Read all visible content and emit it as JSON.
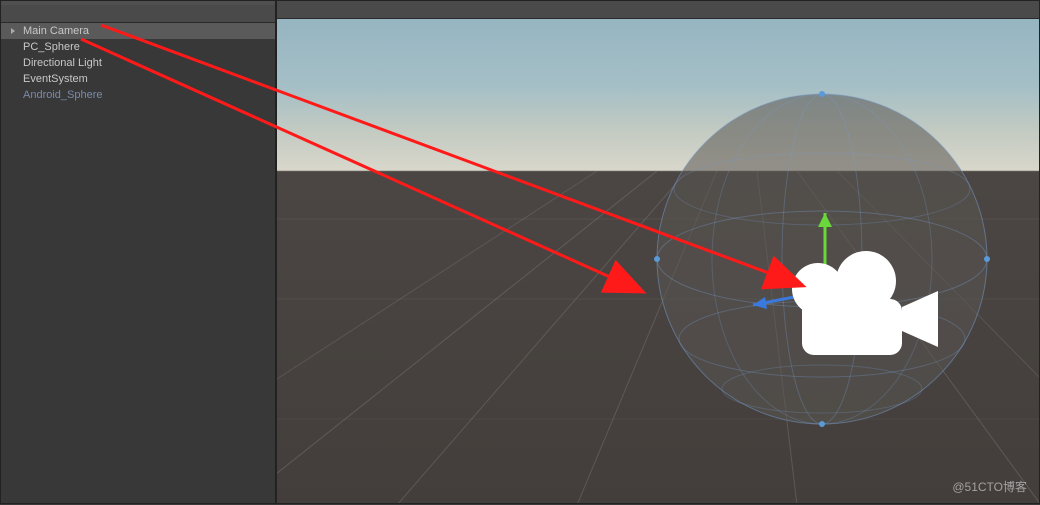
{
  "hierarchy": {
    "items": [
      {
        "label": "Main Camera",
        "selected": true,
        "inactive": false
      },
      {
        "label": "PC_Sphere",
        "selected": false,
        "inactive": false
      },
      {
        "label": "Directional Light",
        "selected": false,
        "inactive": false
      },
      {
        "label": "EventSystem",
        "selected": false,
        "inactive": false
      },
      {
        "label": "Android_Sphere",
        "selected": false,
        "inactive": true
      }
    ]
  },
  "watermark": "@51CTO博客"
}
